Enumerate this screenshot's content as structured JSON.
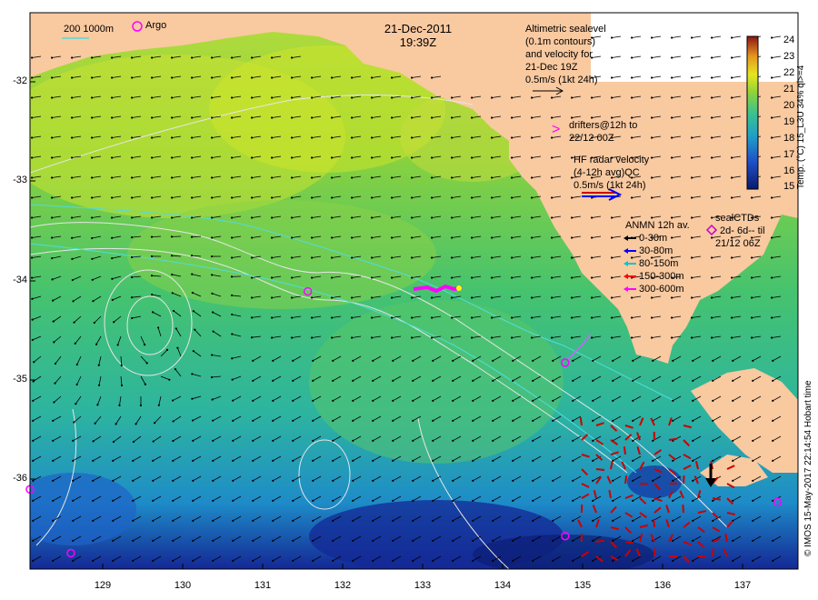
{
  "header": {
    "date": "21-Dec-2011",
    "time": "19:39Z"
  },
  "legend": {
    "isobaths": "200  1000m",
    "argo": "Argo",
    "altimetry_lines": [
      "Altimetric sealevel",
      "(0.1m contours)",
      "and velocity for",
      "21-Dec 19Z",
      "0.5m/s (1kt 24h)"
    ],
    "drifters_lines": [
      "drifters@12h to",
      "22/12 00Z"
    ],
    "drifters_mark": ">",
    "hf_radar_lines": [
      "HF radar velocity",
      "(4-12h avg)QC",
      "0.5m/s (1kt 24h)"
    ],
    "anmn_title": "ANMN 12h av.",
    "anmn_items": [
      {
        "label": "0-30m",
        "color": "#000000"
      },
      {
        "label": "30-80m",
        "color": "#0000ff"
      },
      {
        "label": "80-150m",
        "color": "#00c8c8"
      },
      {
        "label": "150-300m",
        "color": "#ff0000"
      },
      {
        "label": "300-600m",
        "color": "#ff00ff"
      }
    ],
    "seal_lines": [
      "sealCTDs",
      "2d- 6d-- til",
      "21/12 06Z"
    ]
  },
  "colorbar": {
    "ticks": [
      "24",
      "23",
      "22",
      "21",
      "20",
      "19",
      "18",
      "17",
      "16",
      "15"
    ],
    "label": "Temp. (°C) 15_L3U 34% ql>=4",
    "range": [
      15,
      24
    ]
  },
  "axes": {
    "y_ticks": [
      "-32",
      "-33",
      "-34",
      "-35",
      "-36"
    ],
    "x_ticks": [
      "129",
      "130",
      "131",
      "132",
      "133",
      "134",
      "135",
      "136",
      "137"
    ]
  },
  "credit": "© IMOS 15-May-2017 22:14:54 Hobart time",
  "colors": {
    "land": "#f9c9a0",
    "drifter": "#ff00ff",
    "hf_radar": "#cc0000",
    "contour": "#dddddd"
  },
  "map_data": {
    "lon_range": [
      128.2,
      137.6
    ],
    "lat_range": [
      -36.73,
      -31.5
    ],
    "argo_floats": [
      {
        "lon": 131.6,
        "lat": -34.12
      },
      {
        "lon": 134.75,
        "lat": -34.79
      },
      {
        "lon": 134.75,
        "lat": -36.42
      },
      {
        "lon": 128.2,
        "lat": -35.98
      },
      {
        "lon": 128.7,
        "lat": -36.58
      },
      {
        "lon": 137.35,
        "lat": -36.1
      }
    ],
    "cyclonic_eddy_center": {
      "lon": 129.6,
      "lat": -34.5
    }
  }
}
